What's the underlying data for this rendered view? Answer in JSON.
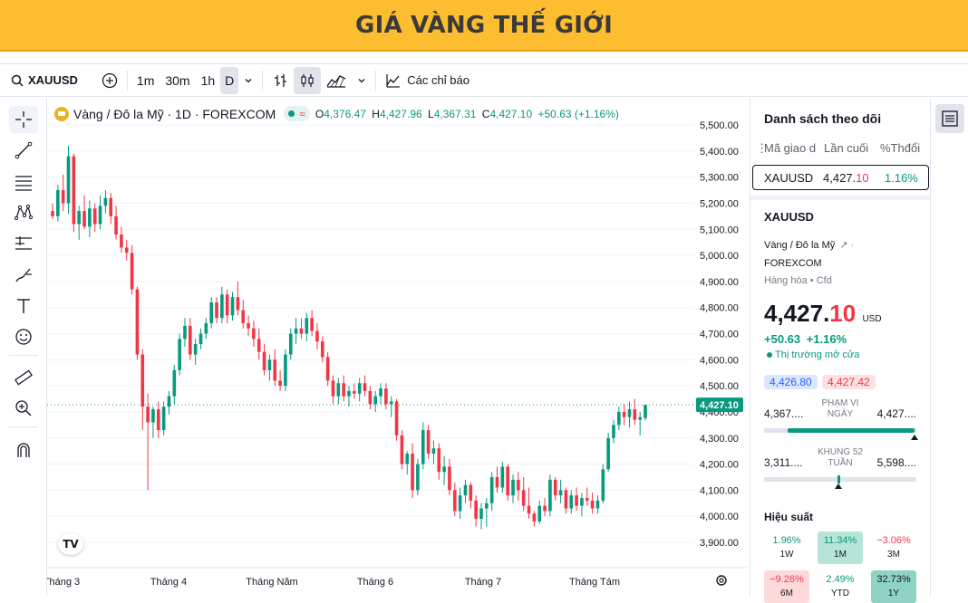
{
  "banner": {
    "title": "GIÁ VÀNG THẾ GIỚI"
  },
  "toolbar": {
    "symbol": "XAUUSD",
    "intervals": [
      "1m",
      "30m",
      "1h",
      "D"
    ],
    "indicators_label": "Các chỉ báo"
  },
  "legend": {
    "title": "Vàng / Đô la Mỹ · 1D · FOREXCOM",
    "o_label": "O",
    "o": "4,376.47",
    "h_label": "H",
    "h": "4,427.96",
    "l_label": "L",
    "l": "4,367.31",
    "c_label": "C",
    "c": "4,427.10",
    "change": "+50.63 (+1.16%)"
  },
  "price_axis": {
    "ticks": [
      "5,500.00",
      "5,400.00",
      "5,300.00",
      "5,200.00",
      "5,100.00",
      "5,000.00",
      "4,900.00",
      "4,800.00",
      "4,700.00",
      "4,600.00",
      "4,500.00",
      "4,400.00",
      "4,300.00",
      "4,200.00",
      "4,100.00",
      "4,000.00",
      "3,900.00"
    ],
    "last_price": "4,427.10"
  },
  "time_axis": {
    "ticks": [
      "Tháng 3",
      "Tháng 4",
      "Tháng Năm",
      "Tháng 6",
      "Tháng 7",
      "Tháng Tám"
    ]
  },
  "chart_data": {
    "type": "candlestick",
    "symbol": "XAUUSD",
    "ylim": [
      3850,
      5540
    ],
    "candles": [
      [
        5170,
        5200,
        5140,
        5150
      ],
      [
        5150,
        5270,
        5130,
        5250
      ],
      [
        5250,
        5310,
        5170,
        5200
      ],
      [
        5200,
        5420,
        5160,
        5380
      ],
      [
        5380,
        5390,
        5090,
        5120
      ],
      [
        5120,
        5190,
        5060,
        5170
      ],
      [
        5170,
        5230,
        5100,
        5110
      ],
      [
        5110,
        5210,
        5070,
        5180
      ],
      [
        5180,
        5200,
        5090,
        5120
      ],
      [
        5120,
        5230,
        5100,
        5190
      ],
      [
        5190,
        5250,
        5160,
        5220
      ],
      [
        5220,
        5240,
        5120,
        5150
      ],
      [
        5150,
        5190,
        5060,
        5080
      ],
      [
        5080,
        5110,
        5010,
        5030
      ],
      [
        5030,
        5060,
        4980,
        5010
      ],
      [
        5010,
        5040,
        4850,
        4870
      ],
      [
        4870,
        4880,
        4600,
        4620
      ],
      [
        4620,
        4640,
        4330,
        4420
      ],
      [
        4420,
        4470,
        4100,
        4360
      ],
      [
        4360,
        4420,
        4300,
        4410
      ],
      [
        4410,
        4440,
        4300,
        4330
      ],
      [
        4330,
        4440,
        4310,
        4420
      ],
      [
        4420,
        4480,
        4390,
        4460
      ],
      [
        4460,
        4580,
        4430,
        4560
      ],
      [
        4560,
        4700,
        4540,
        4680
      ],
      [
        4680,
        4760,
        4650,
        4730
      ],
      [
        4730,
        4760,
        4600,
        4620
      ],
      [
        4620,
        4680,
        4580,
        4660
      ],
      [
        4660,
        4720,
        4640,
        4700
      ],
      [
        4700,
        4760,
        4680,
        4740
      ],
      [
        4740,
        4840,
        4720,
        4820
      ],
      [
        4820,
        4840,
        4740,
        4760
      ],
      [
        4760,
        4880,
        4740,
        4850
      ],
      [
        4850,
        4870,
        4740,
        4770
      ],
      [
        4770,
        4860,
        4750,
        4840
      ],
      [
        4840,
        4900,
        4770,
        4790
      ],
      [
        4790,
        4830,
        4720,
        4740
      ],
      [
        4740,
        4770,
        4690,
        4720
      ],
      [
        4720,
        4750,
        4650,
        4680
      ],
      [
        4680,
        4720,
        4600,
        4630
      ],
      [
        4630,
        4660,
        4540,
        4560
      ],
      [
        4560,
        4620,
        4520,
        4600
      ],
      [
        4600,
        4640,
        4500,
        4520
      ],
      [
        4520,
        4560,
        4480,
        4500
      ],
      [
        4500,
        4640,
        4480,
        4620
      ],
      [
        4620,
        4720,
        4600,
        4700
      ],
      [
        4700,
        4760,
        4660,
        4720
      ],
      [
        4720,
        4760,
        4680,
        4700
      ],
      [
        4700,
        4780,
        4670,
        4760
      ],
      [
        4760,
        4790,
        4690,
        4710
      ],
      [
        4710,
        4740,
        4640,
        4670
      ],
      [
        4670,
        4690,
        4590,
        4610
      ],
      [
        4610,
        4630,
        4500,
        4520
      ],
      [
        4520,
        4540,
        4430,
        4460
      ],
      [
        4460,
        4530,
        4430,
        4510
      ],
      [
        4510,
        4540,
        4440,
        4460
      ],
      [
        4460,
        4500,
        4420,
        4480
      ],
      [
        4480,
        4510,
        4450,
        4470
      ],
      [
        4470,
        4530,
        4440,
        4510
      ],
      [
        4510,
        4540,
        4460,
        4480
      ],
      [
        4480,
        4500,
        4410,
        4430
      ],
      [
        4430,
        4480,
        4400,
        4460
      ],
      [
        4460,
        4510,
        4430,
        4490
      ],
      [
        4490,
        4510,
        4410,
        4430
      ],
      [
        4430,
        4460,
        4380,
        4440
      ],
      [
        4440,
        4450,
        4290,
        4310
      ],
      [
        4310,
        4330,
        4180,
        4200
      ],
      [
        4200,
        4250,
        4160,
        4240
      ],
      [
        4240,
        4280,
        4070,
        4100
      ],
      [
        4100,
        4220,
        4080,
        4200
      ],
      [
        4200,
        4360,
        4180,
        4330
      ],
      [
        4330,
        4350,
        4220,
        4240
      ],
      [
        4240,
        4290,
        4200,
        4260
      ],
      [
        4260,
        4280,
        4140,
        4170
      ],
      [
        4170,
        4230,
        4120,
        4190
      ],
      [
        4190,
        4220,
        4080,
        4100
      ],
      [
        4100,
        4130,
        4000,
        4020
      ],
      [
        4020,
        4110,
        3990,
        4080
      ],
      [
        4080,
        4140,
        4050,
        4120
      ],
      [
        4120,
        4130,
        4030,
        4060
      ],
      [
        4060,
        4080,
        3960,
        3990
      ],
      [
        3990,
        4050,
        3950,
        4030
      ],
      [
        4030,
        4070,
        3960,
        4050
      ],
      [
        4050,
        4170,
        4020,
        4150
      ],
      [
        4150,
        4190,
        4090,
        4110
      ],
      [
        4110,
        4210,
        4090,
        4190
      ],
      [
        4190,
        4200,
        4060,
        4080
      ],
      [
        4080,
        4160,
        4050,
        4140
      ],
      [
        4140,
        4170,
        4060,
        4100
      ],
      [
        4100,
        4150,
        4020,
        4040
      ],
      [
        4040,
        4110,
        3990,
        4010
      ],
      [
        4010,
        4020,
        3960,
        3980
      ],
      [
        3980,
        4060,
        3970,
        4040
      ],
      [
        4040,
        4070,
        4000,
        4020
      ],
      [
        4020,
        4160,
        4000,
        4140
      ],
      [
        4140,
        4150,
        4060,
        4080
      ],
      [
        4080,
        4140,
        4050,
        4100
      ],
      [
        4100,
        4110,
        4010,
        4030
      ],
      [
        4030,
        4100,
        4010,
        4080
      ],
      [
        4080,
        4110,
        4020,
        4040
      ],
      [
        4040,
        4090,
        4000,
        4070
      ],
      [
        4070,
        4110,
        4040,
        4060
      ],
      [
        4060,
        4090,
        4010,
        4030
      ],
      [
        4030,
        4080,
        4010,
        4060
      ],
      [
        4060,
        4200,
        4050,
        4180
      ],
      [
        4180,
        4320,
        4170,
        4300
      ],
      [
        4300,
        4370,
        4280,
        4350
      ],
      [
        4350,
        4420,
        4330,
        4400
      ],
      [
        4400,
        4430,
        4350,
        4380
      ],
      [
        4380,
        4440,
        4340,
        4410
      ],
      [
        4410,
        4450,
        4350,
        4370
      ],
      [
        4370,
        4400,
        4310,
        4380
      ],
      [
        4376.47,
        4427.96,
        4367.31,
        4427.1
      ]
    ]
  },
  "watchlist": {
    "title": "Danh sách theo dõi",
    "col_symbol": "Mã giao d",
    "col_last": "Lần cuối",
    "col_change": "%Thđổi",
    "row_symbol": "XAUUSD",
    "row_last_main": "4,427.",
    "row_last_frac": "10",
    "row_change": "1.16%"
  },
  "details": {
    "symbol": "XAUUSD",
    "name": "Vàng / Đô la Mỹ",
    "exchange_sep": "·",
    "exchange": "FOREXCOM",
    "type1": "Hàng hóa",
    "type2": "Cfd",
    "price_main": "4,427.",
    "price_frac": "10",
    "currency": "USD",
    "change_abs": "+50.63",
    "change_pct": "+1.16%",
    "market_status": "Thị trường mở cửa",
    "bid": "4,426.80",
    "ask": "4,427.42",
    "day_low": "4,367....",
    "day_label": "PHẠM VI NGÀY",
    "day_high": "4,427....",
    "wk_low": "3,311....",
    "wk_label": "KHUNG 52 TUẦN",
    "wk_high": "5,598....",
    "day_range_pos": 0.99,
    "wk_range_pos": 0.49,
    "perf_title": "Hiệu suất",
    "perf": [
      {
        "value": "1.96%",
        "label": "1W"
      },
      {
        "value": "11.34%",
        "label": "1M"
      },
      {
        "value": "−3.06%",
        "label": "3M"
      },
      {
        "value": "−9.26%",
        "label": "6M"
      },
      {
        "value": "2.49%",
        "label": "YTD"
      },
      {
        "value": "32.73%",
        "label": "1Y"
      }
    ]
  },
  "colors": {
    "up": "#089981",
    "down": "#f23645",
    "banner": "#fcbd30"
  }
}
